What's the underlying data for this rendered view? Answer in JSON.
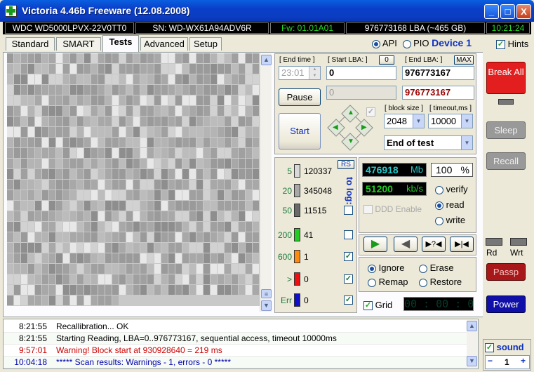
{
  "window": {
    "title": "Victoria 4.46b Freeware (12.08.2008)",
    "buttons": {
      "minimize": "_",
      "maximize": "□",
      "close": "X"
    }
  },
  "infobar": {
    "model": "WDC WD5000LPVX-22V0TT0",
    "serial": "SN: WD-WX61A94ADV6R",
    "firmware": "Fw: 01.01A01",
    "capacity": "976773168 LBA (~465 GB)",
    "clock": "10:21:24",
    "colors": {
      "model": "#ffffff",
      "serial": "#ffffff",
      "firmware": "#22dd22",
      "capacity": "#ffffff",
      "clock": "#22dd22"
    }
  },
  "tabs": [
    {
      "label": "Standard"
    },
    {
      "label": "SMART"
    },
    {
      "label": "Tests"
    },
    {
      "label": "Advanced"
    },
    {
      "label": "Setup"
    }
  ],
  "mode": {
    "api": "API",
    "pio": "PIO",
    "device": "Device 1",
    "hints": "Hints"
  },
  "scan": {
    "end_time_label": "[ End time ]",
    "end_time_value": "23:01",
    "start_lba_label": "[ Start LBA: ]",
    "start_lba_btn": "0",
    "start_lba_value": "0",
    "end_lba_label": "[ End LBA: ]",
    "end_lba_btn": "MAX",
    "end_lba_value": "976773167",
    "current_lba": "0",
    "end_lba_red": "976773167",
    "pause": "Pause",
    "start": "Start",
    "block_size_label": "[ block size ]",
    "block_size": "2048",
    "timeout_label": "[ timeout,ms ]",
    "timeout": "10000",
    "end_action": "End of test"
  },
  "right_buttons": {
    "break": "Break All",
    "sleep": "Sleep",
    "recall": "Recall",
    "rd": "Rd",
    "wrt": "Wrt",
    "passp": "Passp",
    "power": "Power"
  },
  "legend": {
    "rs": "RS",
    "to_log": "to log:",
    "rows": [
      {
        "label": "5",
        "value": "120337",
        "color": "#d8d8d8"
      },
      {
        "label": "20",
        "value": "345048",
        "color": "#a8a8a8"
      },
      {
        "label": "50",
        "value": "11515",
        "color": "#6a6a6a"
      },
      {
        "label": "200",
        "value": "41",
        "color": "#22cc22"
      },
      {
        "label": "600",
        "value": "1",
        "color": "#ff8a10"
      },
      {
        "label": ">",
        "value": "0",
        "color": "#ee1111"
      },
      {
        "label": "Err",
        "value": "0",
        "color": "#1010cc"
      }
    ]
  },
  "stats": {
    "mb": "476918",
    "mb_unit": "Mb",
    "percent": "100",
    "percent_unit": "%",
    "speed": "51200",
    "speed_unit": "kb/s",
    "ddd": "DDD Enable"
  },
  "action": {
    "verify": "verify",
    "read": "read",
    "write": "write"
  },
  "repair": {
    "ignore": "Ignore",
    "erase": "Erase",
    "remap": "Remap",
    "restore": "Restore",
    "grid": "Grid",
    "timer": "00 : 00 : 00"
  },
  "sound": {
    "label": "sound",
    "value": "1",
    "minus": "−",
    "plus": "+"
  },
  "log": [
    {
      "time": "8:21:55",
      "msg": "Recallibration... OK",
      "color": "#000000"
    },
    {
      "time": "8:21:55",
      "msg": "Starting Reading, LBA=0..976773167, sequential access, timeout 10000ms",
      "color": "#000000"
    },
    {
      "time": "9:57:01",
      "msg": "Warning! Block start at 930928640 = 219 ms",
      "color": "#cc0000"
    },
    {
      "time": "10:04:18",
      "msg": "***** Scan results: Warnings - 1, errors - 0 *****",
      "color": "#0000aa"
    }
  ]
}
